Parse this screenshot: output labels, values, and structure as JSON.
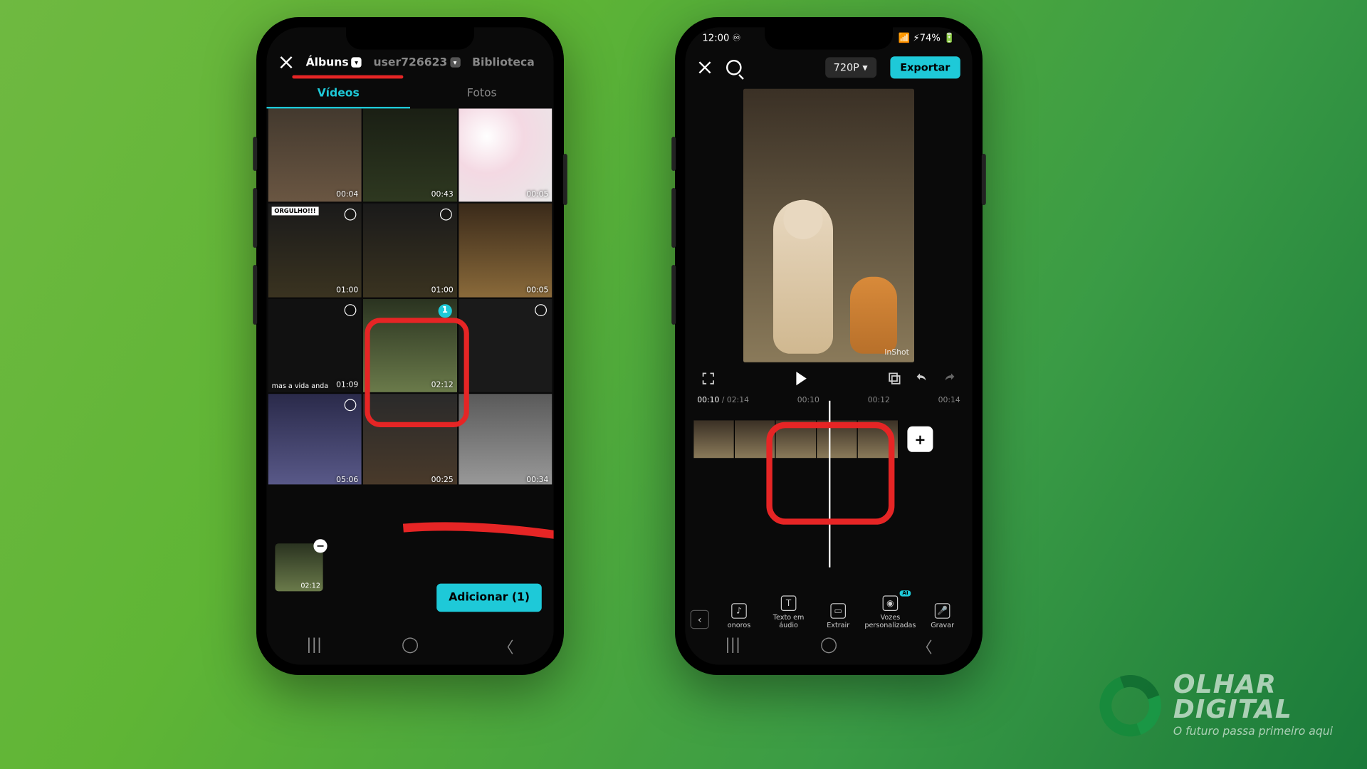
{
  "watermark": {
    "line1": "OLHAR",
    "line2": "DIGITAL",
    "tagline": "O futuro passa primeiro aqui"
  },
  "left": {
    "top": {
      "albums": "Álbuns",
      "user": "user726623",
      "library": "Biblioteca"
    },
    "subtabs": {
      "videos": "Vídeos",
      "photos": "Fotos"
    },
    "cells": [
      {
        "dur": "00:04"
      },
      {
        "dur": "00:43"
      },
      {
        "dur": "00:05"
      },
      {
        "dur": "01:00",
        "label": "ORGULHO!!!"
      },
      {
        "dur": "01:00"
      },
      {
        "dur": "00:05"
      },
      {
        "dur": "01:09",
        "caption": "mas a vida anda"
      },
      {
        "dur": "02:12",
        "selected": "1"
      },
      {
        "dur": ""
      },
      {
        "dur": "05:06"
      },
      {
        "dur": "00:25"
      },
      {
        "dur": "00:34"
      }
    ],
    "tray": {
      "dur": "02:12"
    },
    "add": "Adicionar (1)"
  },
  "right": {
    "status": {
      "time": "12:00 ♾",
      "battery": "📶 ⚡74% 🔋"
    },
    "top": {
      "res": "720P ▾",
      "export": "Exportar"
    },
    "preview_wm": "InShot",
    "ruler": {
      "cur": "00:10",
      "total": "02:14",
      "t1": "00:10",
      "t2": "00:12",
      "t3": "00:14"
    },
    "tools": {
      "back": "‹",
      "t1": "onoros",
      "t2": "Texto em áudio",
      "t3": "Extrair",
      "t4": "Vozes personalizadas",
      "t5": "Gravar"
    }
  }
}
